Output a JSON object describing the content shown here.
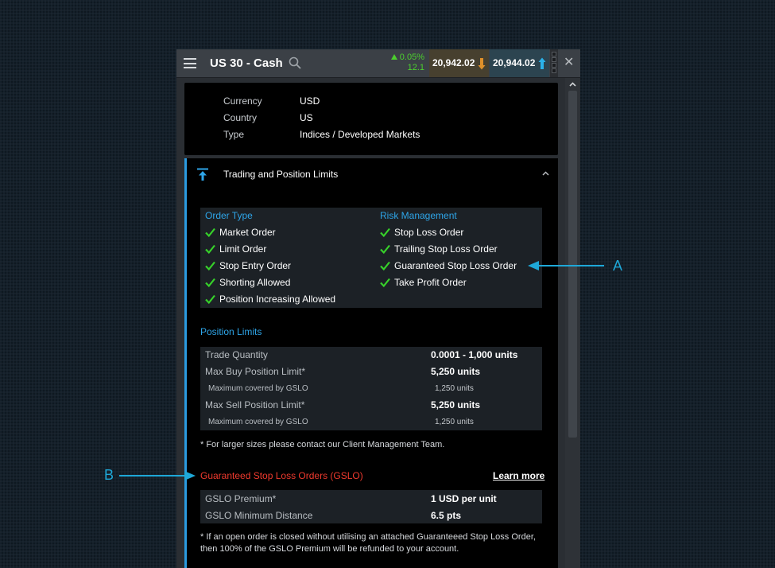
{
  "header": {
    "title": "US 30 - Cash",
    "change_pct": "0.05%",
    "change_pts": "12.1",
    "sell_price": "20,942.02",
    "buy_price": "20,944.02",
    "close_symbol": "✕"
  },
  "info": [
    {
      "label": "Currency",
      "value": "USD"
    },
    {
      "label": "Country",
      "value": "US"
    },
    {
      "label": "Type",
      "value": "Indices / Developed Markets"
    }
  ],
  "section": {
    "title": "Trading and Position Limits",
    "order_type": {
      "heading": "Order Type",
      "items": [
        "Market Order",
        "Limit Order",
        "Stop Entry Order",
        "Shorting Allowed",
        "Position Increasing Allowed"
      ]
    },
    "risk_management": {
      "heading": "Risk Management",
      "items": [
        "Stop Loss Order",
        "Trailing Stop Loss Order",
        "Guaranteed Stop Loss Order",
        "Take Profit Order"
      ]
    },
    "position_limits": {
      "heading": "Position Limits",
      "rows": [
        {
          "label": "Trade Quantity",
          "value": "0.0001 - 1,000 units"
        },
        {
          "label": "Max Buy Position Limit*",
          "value": "5,250 units"
        },
        {
          "label": "Maximum covered by GSLO",
          "value": "1,250 units"
        },
        {
          "label": "Max Sell Position Limit*",
          "value": "5,250 units"
        },
        {
          "label": "Maximum covered by GSLO",
          "value": "1,250 units"
        }
      ],
      "note": "* For larger sizes please contact our Client Management Team."
    },
    "gslo": {
      "heading": "Guaranteed Stop Loss Orders (GSLO)",
      "learn_more": "Learn more",
      "rows": [
        {
          "label": "GSLO Premium*",
          "value": "1 USD per unit"
        },
        {
          "label": "GSLO Minimum Distance",
          "value": "6.5 pts"
        }
      ],
      "note_line1": "* If an open order is closed without utilising an attached Guaranteeed Stop Loss Order,",
      "note_line2": "then 100% of the GSLO Premium will be refunded to your account."
    }
  },
  "annotations": {
    "a": "A",
    "b": "B"
  },
  "colors": {
    "accent": "#2ea5e8",
    "check": "#37d12a",
    "gslo_red": "#f03a2e",
    "annotation": "#1ea8d8"
  }
}
